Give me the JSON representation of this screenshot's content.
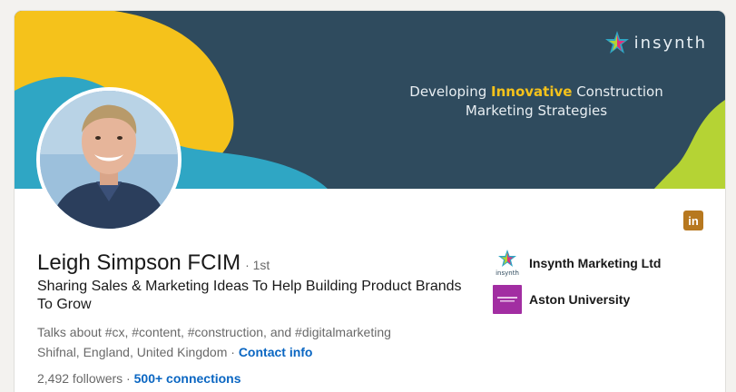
{
  "banner": {
    "logo_text": "insynth",
    "tagline_pre": "Developing ",
    "tagline_highlight": "Innovative",
    "tagline_post": " Construction",
    "tagline_line2": "Marketing Strategies"
  },
  "profile": {
    "name": "Leigh Simpson FCIM",
    "degree": "· 1st",
    "headline": "Sharing Sales & Marketing Ideas To Help Building Product Brands To Grow",
    "talks_about": "Talks about #cx, #content, #construction, and #digitalmarketing",
    "location": "Shifnal, England, United Kingdom",
    "separator": " · ",
    "contact_info": "Contact info",
    "followers": "2,492 followers",
    "connections": "500+ connections"
  },
  "badge_icon": "linkedin-icon",
  "organizations": [
    {
      "name": "Insynth Marketing Ltd",
      "logo_caption": "insynth"
    },
    {
      "name": "Aston University"
    }
  ],
  "colors": {
    "banner_bg": "#2f4b5e",
    "accent_yellow": "#f5c21b",
    "accent_teal": "#2fa6c4",
    "accent_lime": "#b5d334",
    "link": "#0a66c2",
    "aston": "#a22ea2"
  }
}
